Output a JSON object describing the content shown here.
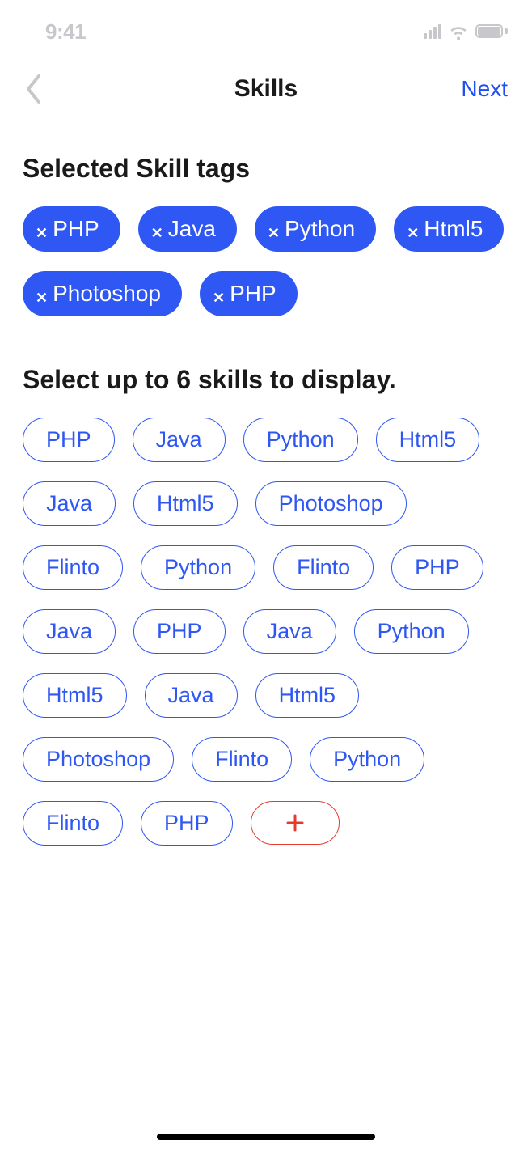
{
  "statusBar": {
    "time": "9:41"
  },
  "nav": {
    "title": "Skills",
    "nextLabel": "Next"
  },
  "sections": {
    "selectedTitle": "Selected Skill tags",
    "availableTitle": "Select up to 6 skills to display."
  },
  "selectedSkills": [
    {
      "label": "PHP"
    },
    {
      "label": "Java"
    },
    {
      "label": "Python"
    },
    {
      "label": "Html5"
    },
    {
      "label": "Photoshop"
    },
    {
      "label": "PHP"
    }
  ],
  "availableSkills": [
    {
      "label": "PHP"
    },
    {
      "label": "Java"
    },
    {
      "label": "Python"
    },
    {
      "label": "Html5"
    },
    {
      "label": "Java"
    },
    {
      "label": "Html5"
    },
    {
      "label": "Photoshop"
    },
    {
      "label": "Flinto"
    },
    {
      "label": "Python"
    },
    {
      "label": "Flinto"
    },
    {
      "label": "PHP"
    },
    {
      "label": "Java"
    },
    {
      "label": "PHP"
    },
    {
      "label": "Java"
    },
    {
      "label": "Python"
    },
    {
      "label": "Html5"
    },
    {
      "label": "Java"
    },
    {
      "label": "Html5"
    },
    {
      "label": "Photoshop"
    },
    {
      "label": "Flinto"
    },
    {
      "label": "Python"
    },
    {
      "label": "Flinto"
    },
    {
      "label": "PHP"
    }
  ],
  "colors": {
    "primary": "#2f57f3",
    "danger": "#e63a2e"
  }
}
